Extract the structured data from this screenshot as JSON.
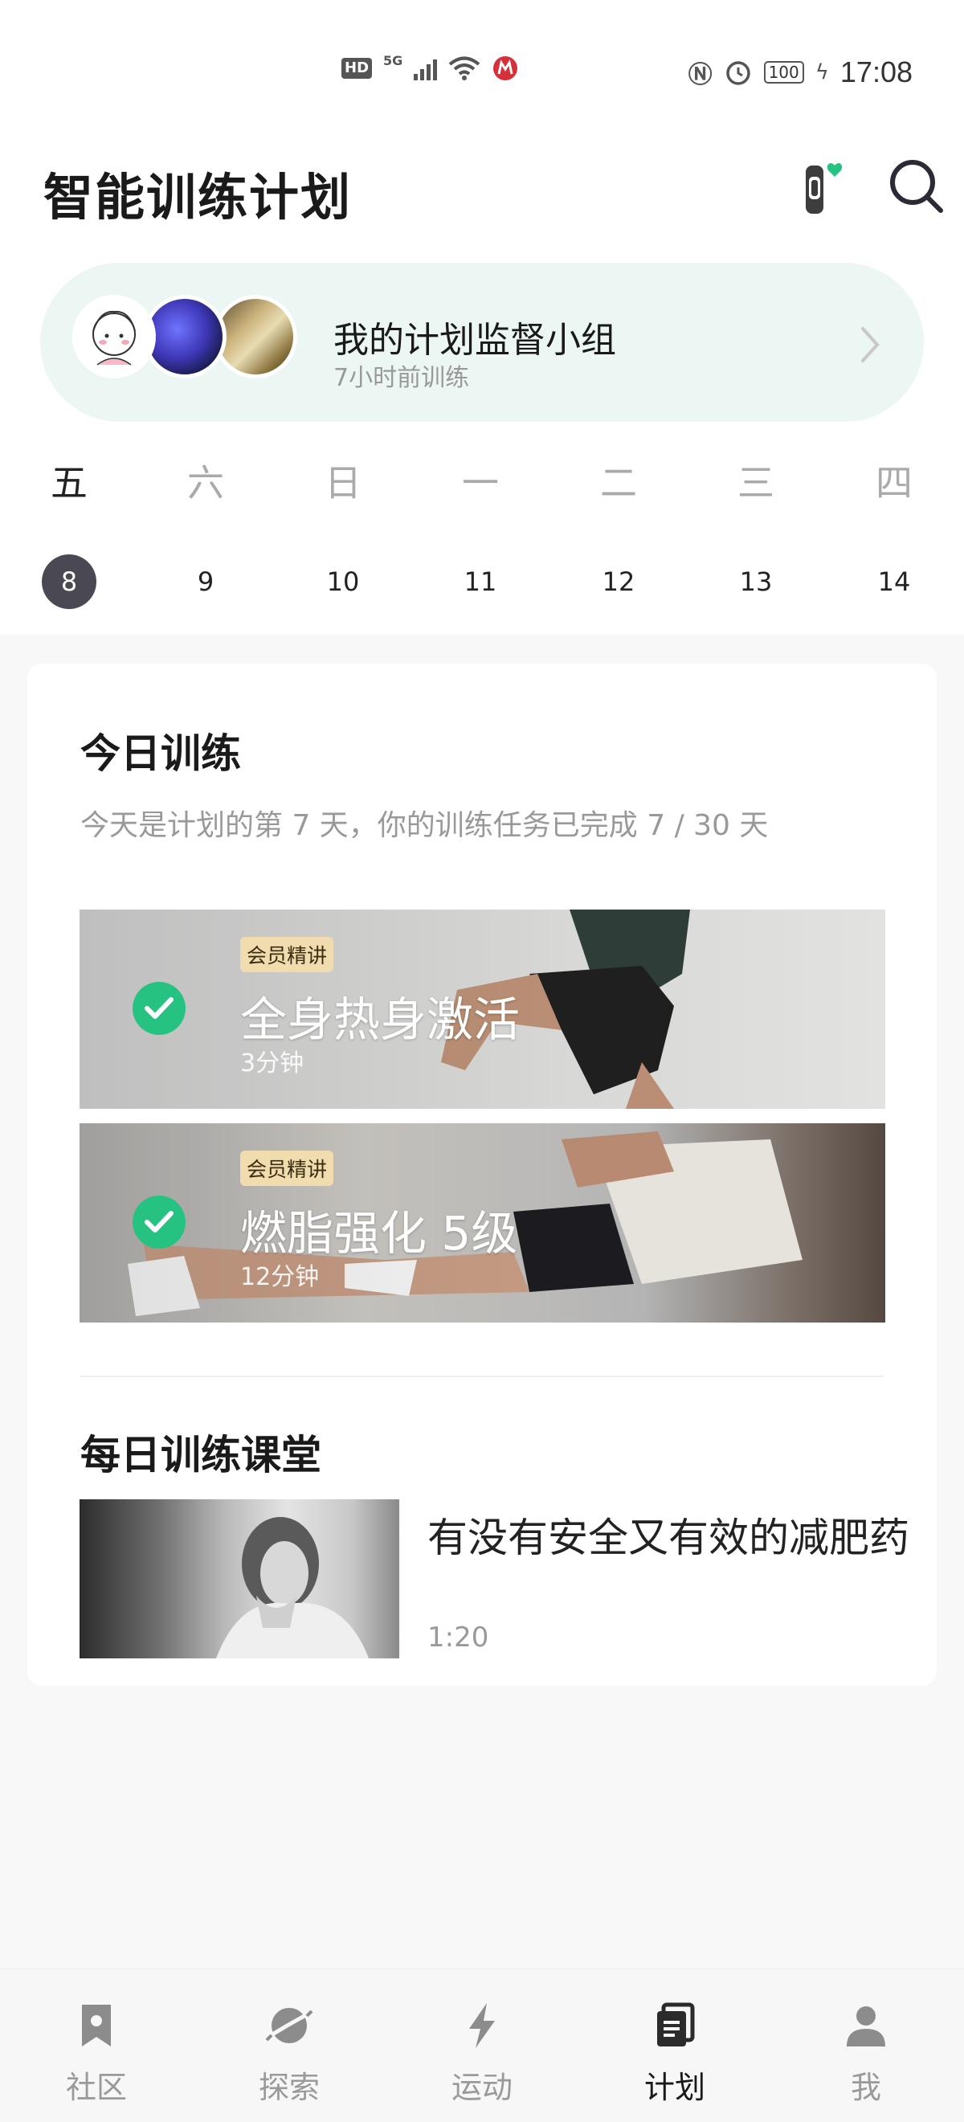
{
  "status_bar": {
    "hd": "HD",
    "network": "5G",
    "battery": "100",
    "time": "17:08"
  },
  "header": {
    "title": "智能训练计划"
  },
  "group": {
    "title": "我的计划监督小组",
    "subtitle": "7小时前训练"
  },
  "week": {
    "days": [
      "五",
      "六",
      "日",
      "一",
      "二",
      "三",
      "四"
    ],
    "dates": [
      "8",
      "9",
      "10",
      "11",
      "12",
      "13",
      "14"
    ],
    "selected_index": 0
  },
  "today": {
    "title": "今日训练",
    "description": "今天是计划的第 7 天，你的训练任务已完成 7 / 30 天",
    "workouts": [
      {
        "badge": "会员精讲",
        "title": "全身热身激活",
        "duration": "3分钟",
        "completed": true
      },
      {
        "badge": "会员精讲",
        "title": "燃脂强化 5级",
        "duration": "12分钟",
        "completed": true
      }
    ]
  },
  "daily_class": {
    "title": "每日训练课堂",
    "item": {
      "title": "有没有安全又有效的减肥药",
      "duration": "1:20"
    }
  },
  "nav": {
    "items": [
      {
        "label": "社区",
        "icon": "bookmark-icon"
      },
      {
        "label": "探索",
        "icon": "planet-icon"
      },
      {
        "label": "运动",
        "icon": "lightning-icon"
      },
      {
        "label": "计划",
        "icon": "plan-list-icon"
      },
      {
        "label": "我",
        "icon": "person-icon"
      }
    ],
    "active_index": 3
  },
  "colors": {
    "accent_green": "#26c281",
    "banner_bg": "#ecf6f2",
    "badge_bg": "#f0dcaf",
    "selected_date_bg": "#4a4852"
  }
}
